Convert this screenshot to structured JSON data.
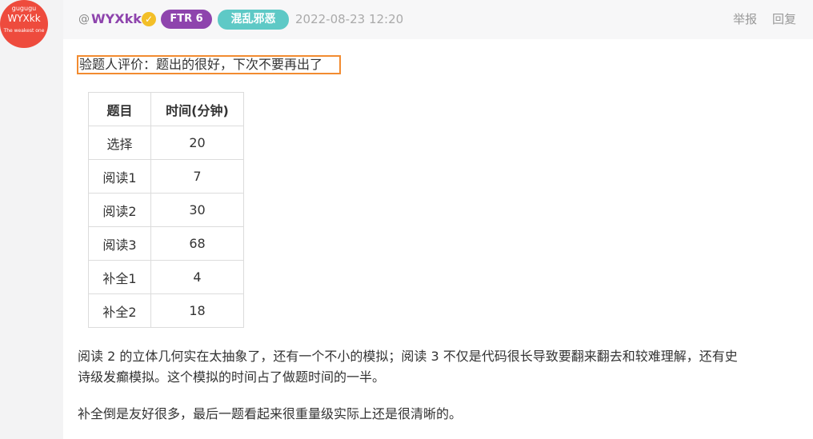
{
  "avatar": {
    "top_text": "gugugu",
    "name": "WYXkk",
    "bottom_text": "The weakest one",
    "color": "#ee4b3d"
  },
  "post_header": {
    "at_symbol": "@",
    "username": "WYXkk",
    "verified_icon": "check-badge-icon",
    "badge_level": "FTR 6",
    "badge_tag": "混乱邪恶",
    "timestamp": "2022-08-23 12:20",
    "report_label": "举报",
    "reply_label": "回复",
    "colors": {
      "username": "#8e44ad",
      "badge_level": "#8e44ad",
      "badge_tag": "#5ec9c6",
      "verified": "#f3bf28"
    }
  },
  "post_body": {
    "highlighted_line": "验题人评价：题出的很好，下次不要再出了",
    "table": {
      "headers": [
        "题目",
        "时间(分钟)"
      ],
      "rows": [
        [
          "选择",
          "20"
        ],
        [
          "阅读1",
          "7"
        ],
        [
          "阅读2",
          "30"
        ],
        [
          "阅读3",
          "68"
        ],
        [
          "补全1",
          "4"
        ],
        [
          "补全2",
          "18"
        ]
      ]
    },
    "paragraph_1_line_1": "阅读 2 的立体几何实在太抽象了，还有一个不小的模拟；阅读 3 不仅是代码很长导致要翻来翻去和较难理解，还有史",
    "paragraph_1_line_2": "诗级发癫模拟。这个模拟的时间占了做题时间的一半。",
    "paragraph_2": "补全倒是友好很多，最后一题看起来很重量级实际上还是很清晰的。",
    "highlight_color": "#f28b30"
  }
}
